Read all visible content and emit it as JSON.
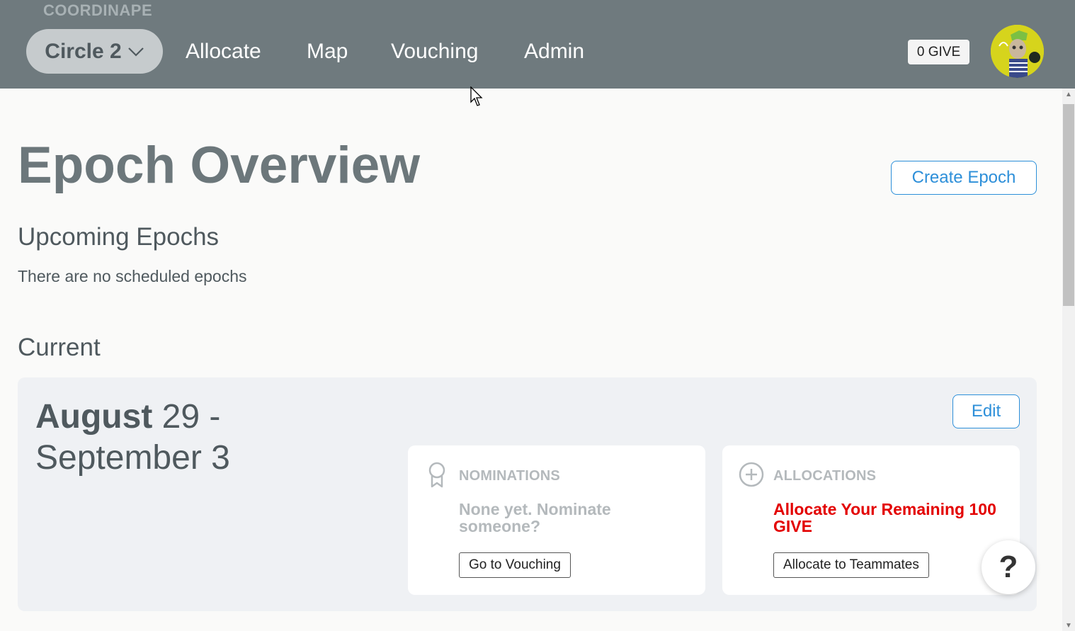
{
  "header": {
    "brand": "COORDINAPE",
    "circle_selector": "Circle 2",
    "nav": [
      "Allocate",
      "Map",
      "Vouching",
      "Admin"
    ],
    "give_balance": "0 GIVE"
  },
  "main": {
    "title": "Epoch Overview",
    "create_epoch_label": "Create Epoch",
    "upcoming_heading": "Upcoming Epochs",
    "upcoming_empty": "There are no scheduled epochs",
    "current_heading": "Current",
    "current_epoch": {
      "month_start": "August",
      "range_rest": " 29 - September 3",
      "edit_label": "Edit",
      "nominations": {
        "label": "NOMINATIONS",
        "text": "None yet. Nominate someone?",
        "button": "Go to Vouching"
      },
      "allocations": {
        "label": "ALLOCATIONS",
        "text": "Allocate Your Remaining 100 GIVE",
        "button": "Allocate to Teammates"
      }
    }
  },
  "help_label": "?",
  "colors": {
    "header_bg": "#6f7a7e",
    "accent_blue": "#2d8fd9",
    "alert_red": "#e30000",
    "muted_gray": "#b4b9bc"
  },
  "icons": [
    "chevron-down-icon",
    "ribbon-icon",
    "plus-circle-icon",
    "cursor-icon",
    "avatar"
  ]
}
